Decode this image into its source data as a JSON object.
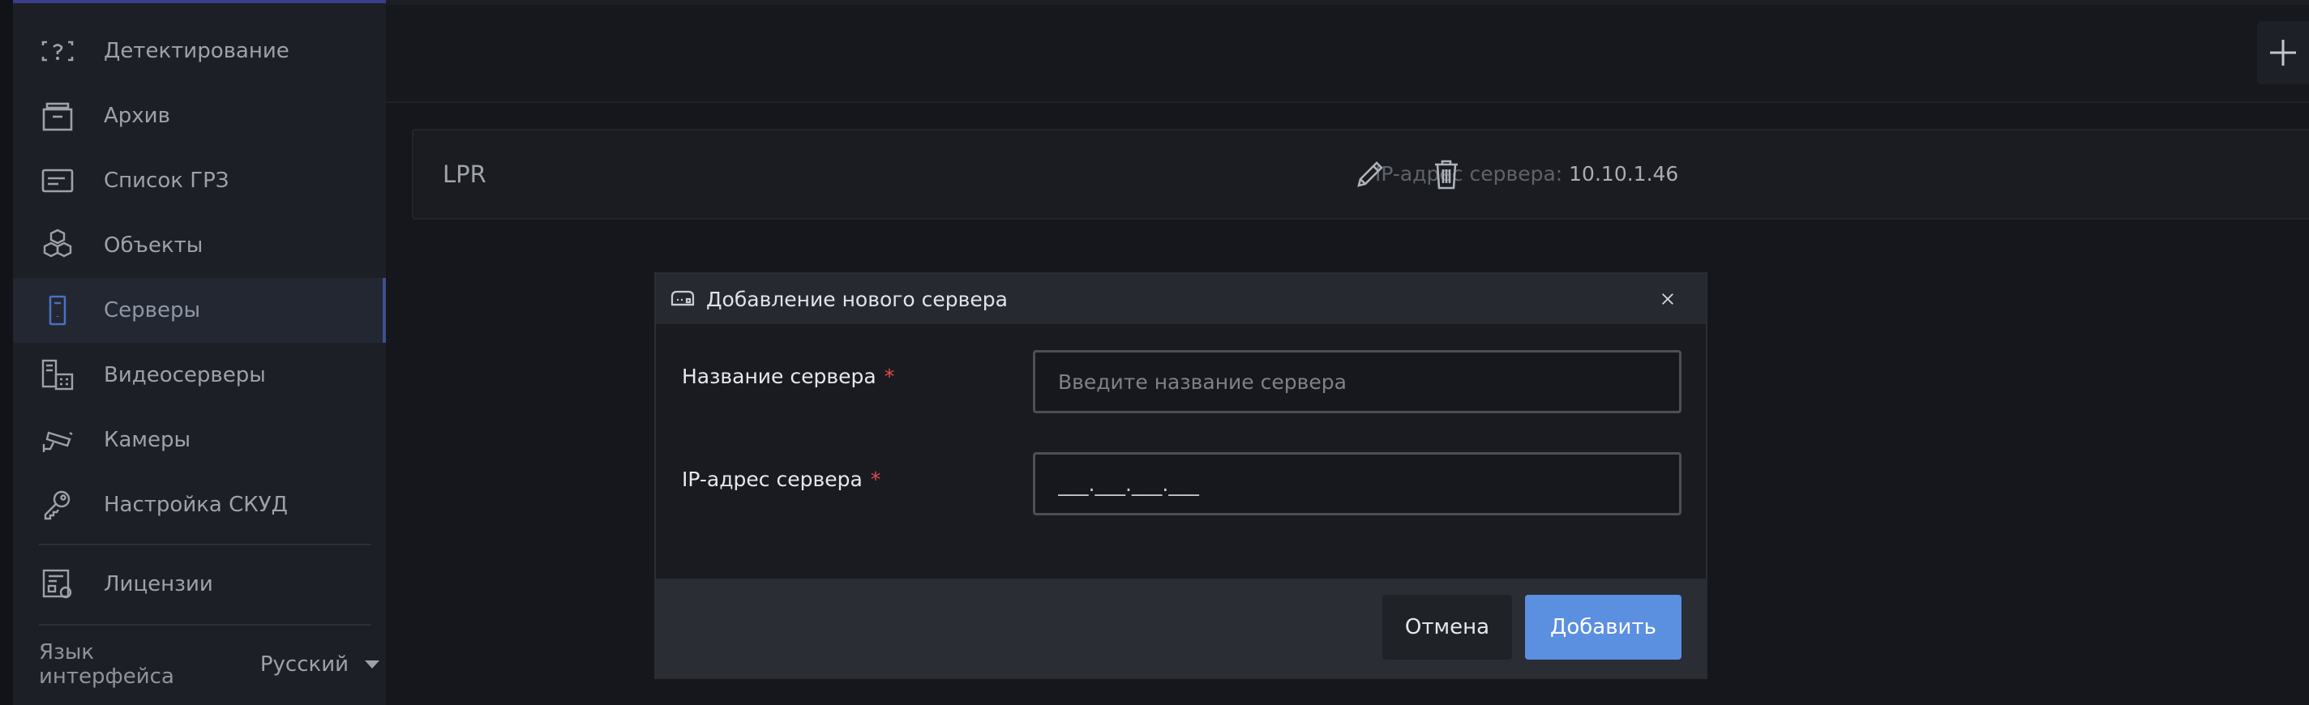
{
  "sidebar": {
    "items": [
      {
        "label": "Детектирование",
        "icon": "detection-icon"
      },
      {
        "label": "Архив",
        "icon": "archive-icon"
      },
      {
        "label": "Список ГРЗ",
        "icon": "plate-list-icon"
      },
      {
        "label": "Объекты",
        "icon": "objects-icon"
      },
      {
        "label": "Серверы",
        "icon": "server-icon",
        "active": true
      },
      {
        "label": "Видеосерверы",
        "icon": "video-server-icon"
      },
      {
        "label": "Камеры",
        "icon": "camera-icon"
      },
      {
        "label": "Настройка СКУД",
        "icon": "access-control-icon"
      },
      {
        "label": "Лицензии",
        "icon": "license-icon"
      }
    ],
    "language": {
      "label": "Язык интерфейса",
      "value": "Русский"
    }
  },
  "server_card": {
    "name": "LPR",
    "ip_label": "IP-адрес сервера:",
    "ip_value": "10.10.1.46"
  },
  "modal": {
    "title": "Добавление нового сервера",
    "name_field": {
      "label": "Название сервера",
      "required_mark": "*",
      "placeholder": "Введите название сервера",
      "value": ""
    },
    "ip_field": {
      "label": "IP-адрес сервера",
      "required_mark": "*",
      "value": "___.___.___.___"
    },
    "cancel_label": "Отмена",
    "add_label": "Добавить"
  },
  "colors": {
    "accent": "#5b8fe0",
    "required": "#e04b4b",
    "active_marker": "#3f4f8f"
  }
}
